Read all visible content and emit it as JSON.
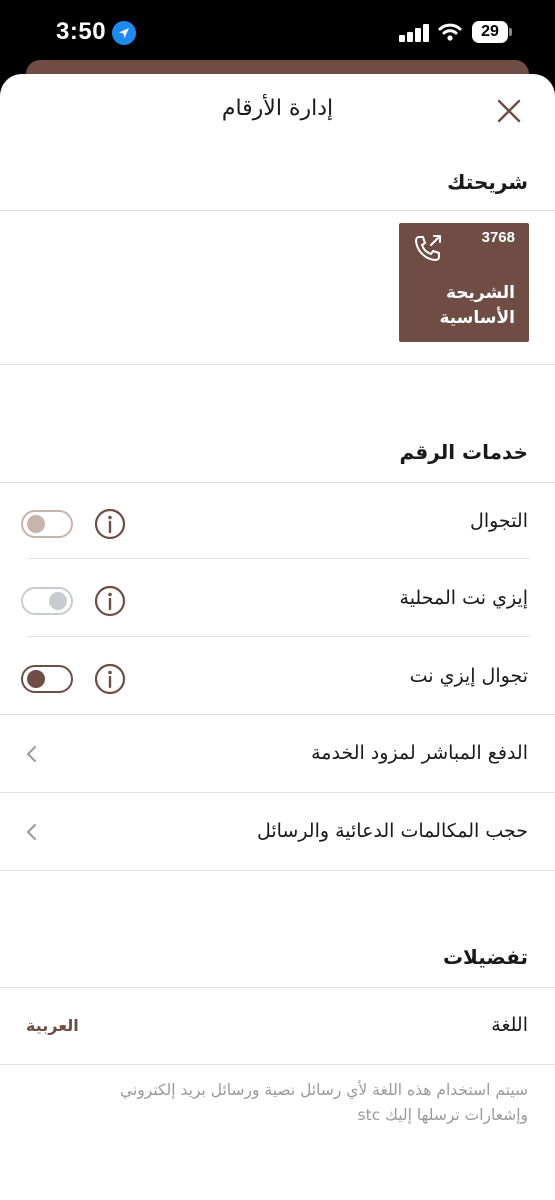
{
  "status_bar": {
    "time": "3:50",
    "battery": "29"
  },
  "header": {
    "title": "إدارة الأرقام"
  },
  "sim_section": {
    "title": "شريحتك",
    "card": {
      "number": "3768",
      "label": "الشريحة الأساسية",
      "color": "#6f4d45"
    }
  },
  "services": {
    "title": "خدمات الرقم",
    "items": [
      {
        "label": "التجوال",
        "toggle_state": "off-disabled"
      },
      {
        "label": "إيزي نت المحلية",
        "toggle_state": "off-disabled"
      },
      {
        "label": "تجوال إيزي نت",
        "toggle_state": "on"
      }
    ],
    "links": [
      {
        "label": "الدفع المباشر لمزود الخدمة"
      },
      {
        "label": "حجب المكالمات الدعائية والرسائل"
      }
    ]
  },
  "preferences": {
    "title": "تفضيلات",
    "language": {
      "label": "اللغة",
      "value": "العربية"
    },
    "note": "سيتم استخدام هذه اللغة لأي رسائل نصية ورسائل بريد إلكتروني وإشعارات ترسلها إليك stc"
  },
  "colors": {
    "brand": "#6f4d45",
    "toggle_off": "#c9b3ad",
    "toggle_gray": "#c8ccd0"
  }
}
